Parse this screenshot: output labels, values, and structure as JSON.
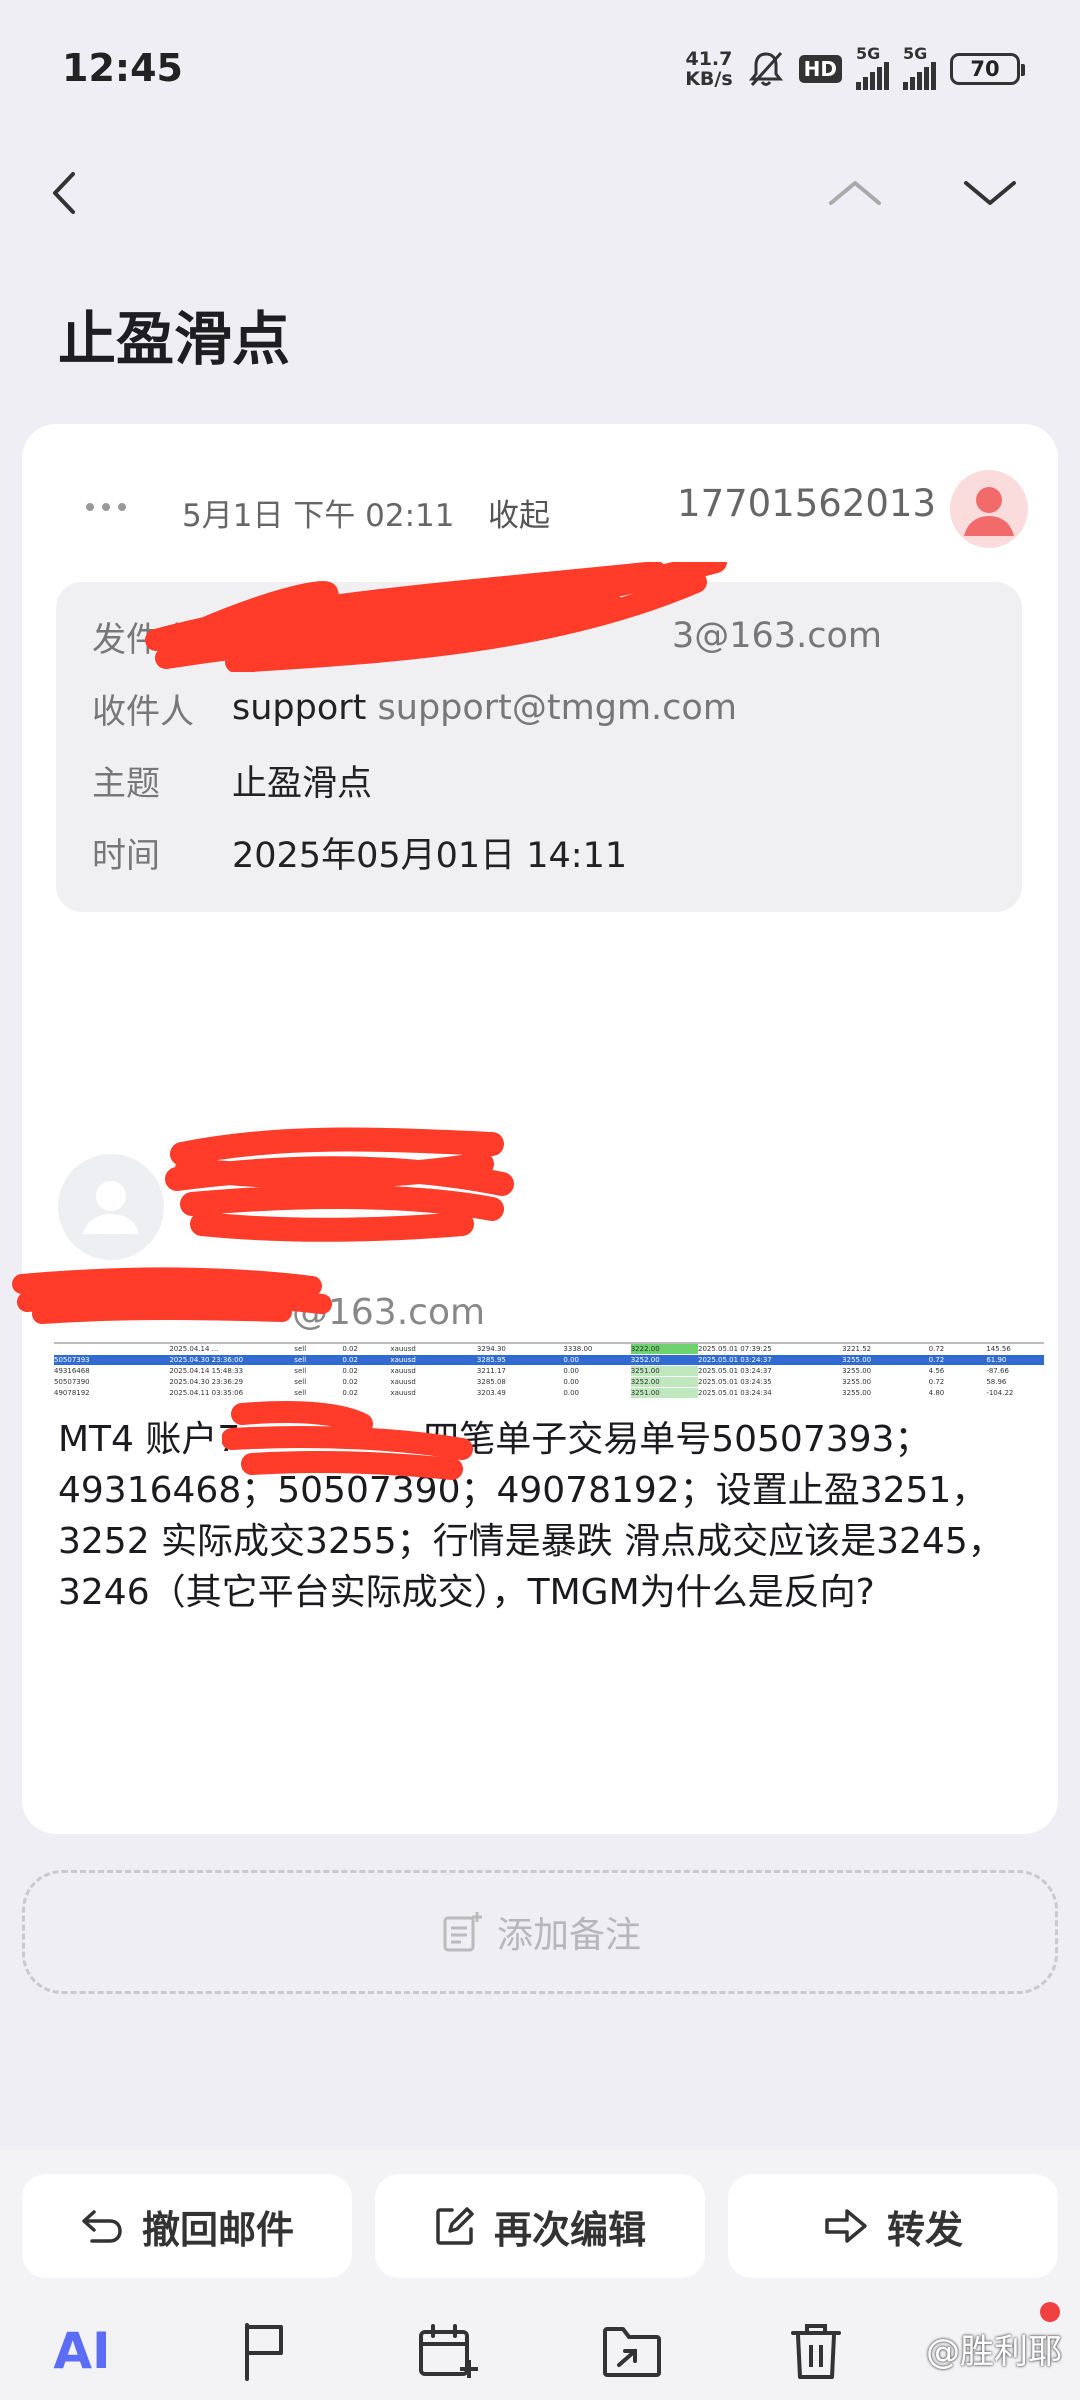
{
  "status_bar": {
    "time": "12:45",
    "net_speed_value": "41.7",
    "net_speed_unit": "KB/s",
    "hd_badge": "HD",
    "sim1_label": "5G",
    "sim2_label": "5G",
    "battery": "70",
    "icons": [
      "mute-bell-icon",
      "signal-icon",
      "battery-icon"
    ]
  },
  "nav": {
    "back_icon": "chevron-left-icon",
    "prev_icon": "chevron-up-icon",
    "next_icon": "chevron-down-icon"
  },
  "page_title": "止盈滑点",
  "mail": {
    "date": "5月1日 下午 02:11",
    "collapse_label": "收起",
    "phone": "17701562013",
    "header": {
      "from_label": "发件人",
      "from_value_visible": "3@163.com",
      "to_label": "收件人",
      "to_name": "support",
      "to_email": "support@tmgm.com",
      "subject_label": "主题",
      "subject_value": "止盈滑点",
      "time_label": "时间",
      "time_value": "2025年05月01日 14:11"
    },
    "sender_email_visible": "@163.com",
    "body_line1_a": "MT4 账户7",
    "body_line1_b": "四笔单子交易单号50507393；",
    "body_rest": "49316468；50507390；49078192；设置止盈3251，3252  实际成交3255；行情是暴跌 滑点成交应该是3245，3246（其它平台实际成交），TMGM为什么是反向?",
    "trade_rows": [
      [
        "",
        "2025.04.14 ...",
        "sell",
        "0.02",
        "xauusd",
        "3294.30",
        "3338.00",
        "3222.00",
        "2025.05.01 07:39:25",
        "3221.52",
        "0.72",
        "145.56"
      ],
      [
        "50507393",
        "2025.04.30 23:36:00",
        "sell",
        "0.02",
        "xauusd",
        "3285.95",
        "0.00",
        "3252.00",
        "2025.05.01 03:24:37",
        "3255.00",
        "0.72",
        "61.90"
      ],
      [
        "49316468",
        "2025.04.14 15:48:33",
        "sell",
        "0.02",
        "xauusd",
        "3211.17",
        "0.00",
        "3251.00",
        "2025.05.01 03:24:37",
        "3255.00",
        "4.56",
        "-87.66"
      ],
      [
        "50507390",
        "2025.04.30 23:36:29",
        "sell",
        "0.02",
        "xauusd",
        "3285.08",
        "0.00",
        "3252.00",
        "2025.05.01 03:24:35",
        "3255.00",
        "0.72",
        "58.96"
      ],
      [
        "49078192",
        "2025.04.11 03:35:06",
        "sell",
        "0.02",
        "xauusd",
        "3203.49",
        "0.00",
        "3251.00",
        "2025.05.01 03:24:34",
        "3255.00",
        "4.80",
        "-104.22"
      ]
    ]
  },
  "add_note_label": "添加备注",
  "actions": {
    "recall_label": "撤回邮件",
    "edit_label": "再次编辑",
    "forward_label": "转发"
  },
  "toolbar": {
    "ai_label": "AI"
  },
  "watermark": "@胜利耶",
  "colors": {
    "background": "#eeeef4",
    "card": "#ffffff",
    "scribble_red": "#ff3b2a",
    "ai_blue": "#5b6cf6",
    "avatar_pink": "#fbdcdc"
  }
}
